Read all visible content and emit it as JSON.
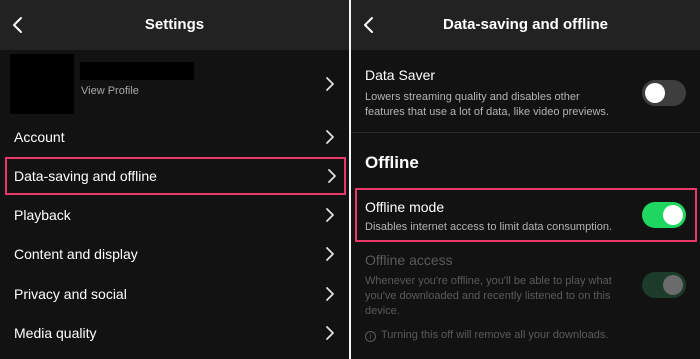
{
  "left": {
    "header": {
      "title": "Settings"
    },
    "profile": {
      "view_profile": "View Profile"
    },
    "menu": [
      {
        "label": "Account"
      },
      {
        "label": "Data-saving and offline"
      },
      {
        "label": "Playback"
      },
      {
        "label": "Content and display"
      },
      {
        "label": "Privacy and social"
      },
      {
        "label": "Media quality"
      }
    ]
  },
  "right": {
    "header": {
      "title": "Data-saving and offline"
    },
    "data_saver": {
      "title": "Data Saver",
      "desc_line1": "Lowers streaming quality and disables other",
      "desc_line2": "features that use a lot of data, like video previews.",
      "enabled": false
    },
    "offline_section": {
      "title": "Offline"
    },
    "offline_mode": {
      "title": "Offline mode",
      "desc": "Disables internet access to limit data consumption.",
      "enabled": true
    },
    "offline_access": {
      "title": "Offline access",
      "desc_line1": "Whenever you're offline, you'll be able to play what",
      "desc_line2": "you've downloaded and recently listened to on this",
      "desc_line3": "device.",
      "info": "Turning this off will remove all your downloads.",
      "enabled": true,
      "disabled": true
    }
  },
  "colors": {
    "accent_green": "#1ed760",
    "highlight_pink": "#e8386a",
    "background": "#121212",
    "header": "#222222"
  },
  "icons": [
    "back-arrow-icon",
    "chevron-right-icon",
    "info-icon"
  ]
}
